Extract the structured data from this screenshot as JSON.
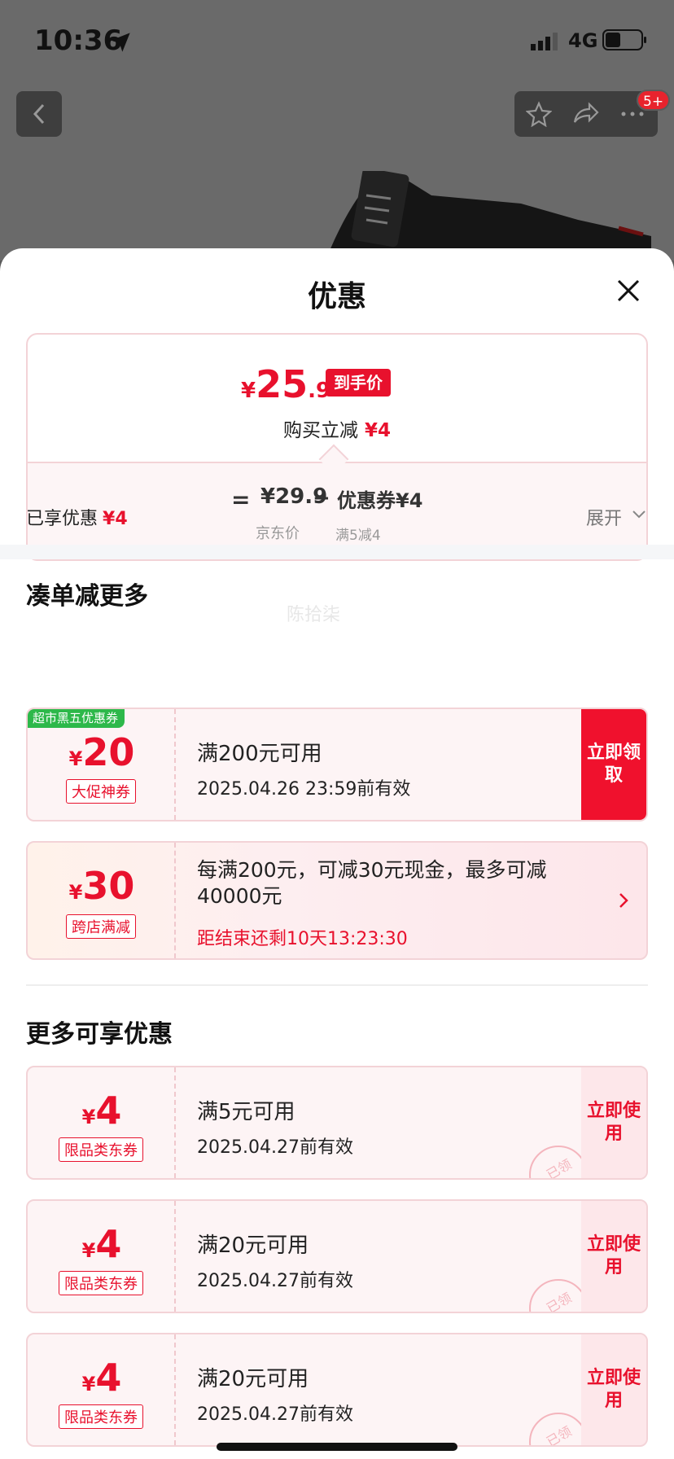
{
  "status_bar": {
    "time": "10:36",
    "network": "4G"
  },
  "product_header": {
    "badge": "5+"
  },
  "sheet": {
    "title": "优惠",
    "price_card": {
      "yen": "¥",
      "hand_price_int": "25",
      "hand_price_dec": ".9",
      "hand_price_badge": "到手价",
      "reduce_label": "购买立减",
      "reduce_amount": "¥4",
      "equals": "=",
      "jd_price": "¥29.9",
      "minus": "−",
      "coupon_label": "优惠券¥4",
      "jd_price_sub": "京东价",
      "coupon_sub": "满5减4"
    },
    "enjoyed_label": "已享优惠",
    "enjoyed_amount": "¥4",
    "expand_label": "展开",
    "watermark": "陈拾柒",
    "section1_title": "凑单减更多",
    "section2_title": "更多可享优惠",
    "coupons_top": [
      {
        "corner": "超市黑五优惠券",
        "yen": "¥",
        "value": "20",
        "tag": "大促神券",
        "title": "满200元可用",
        "subtitle": "2025.04.26 23:59前有效",
        "action": "立即领取"
      }
    ],
    "promo": {
      "yen": "¥",
      "value": "30",
      "tag": "跨店满减",
      "title": "每满200元，可减30元现金，最多可减40000元",
      "countdown": "距结束还剩10天13:23:30"
    },
    "coupons_more": [
      {
        "yen": "¥",
        "value": "4",
        "tag": "限品类东券",
        "title": "满5元可用",
        "subtitle": "2025.04.27前有效",
        "action": "立即使用",
        "stamp": "已领"
      },
      {
        "yen": "¥",
        "value": "4",
        "tag": "限品类东券",
        "title": "满20元可用",
        "subtitle": "2025.04.27前有效",
        "action": "立即使用",
        "stamp": "已领"
      },
      {
        "yen": "¥",
        "value": "4",
        "tag": "限品类东券",
        "title": "满20元可用",
        "subtitle": "2025.04.27前有效",
        "action": "立即使用",
        "stamp": "已领"
      }
    ]
  }
}
